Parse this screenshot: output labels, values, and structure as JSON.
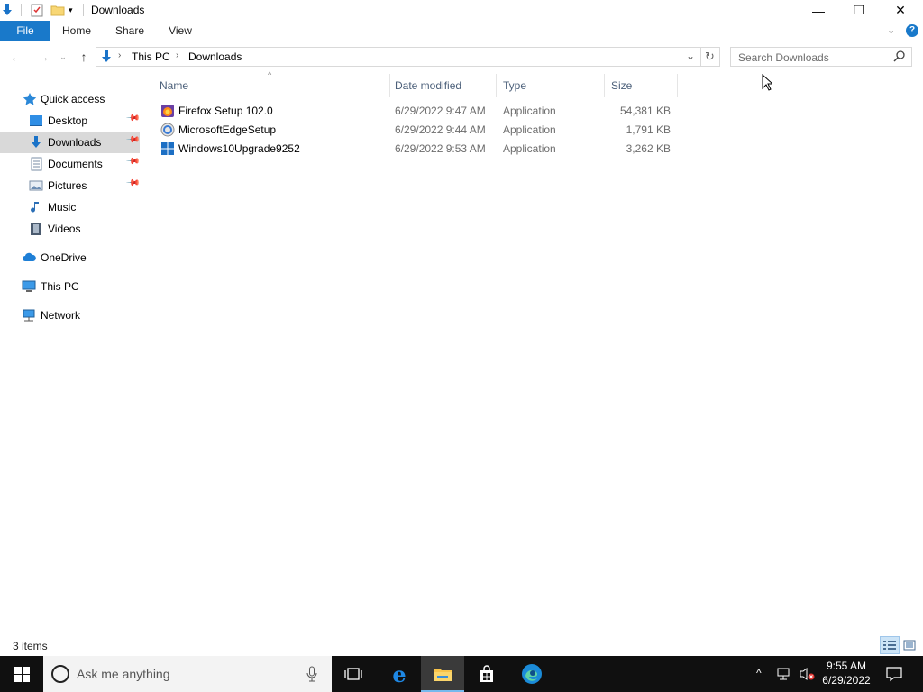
{
  "window": {
    "title": "Downloads",
    "minimize_glyph": "—",
    "maximize_glyph": "❐",
    "close_glyph": "✕"
  },
  "ribbon": {
    "tabs": [
      {
        "label": "File"
      },
      {
        "label": "Home"
      },
      {
        "label": "Share"
      },
      {
        "label": "View"
      }
    ]
  },
  "address": {
    "crumbs": [
      "This PC",
      "Downloads"
    ],
    "search_placeholder": "Search Downloads"
  },
  "nav": {
    "quick_access": "Quick access",
    "items": [
      {
        "label": "Desktop",
        "icon": "desktop-folder-icon",
        "pinned": true
      },
      {
        "label": "Downloads",
        "icon": "downloads-folder-icon",
        "pinned": true,
        "selected": true
      },
      {
        "label": "Documents",
        "icon": "documents-folder-icon",
        "pinned": true
      },
      {
        "label": "Pictures",
        "icon": "pictures-folder-icon",
        "pinned": true
      },
      {
        "label": "Music",
        "icon": "music-folder-icon",
        "pinned": false
      },
      {
        "label": "Videos",
        "icon": "videos-folder-icon",
        "pinned": false
      }
    ],
    "onedrive": "OneDrive",
    "this_pc": "This PC",
    "network": "Network"
  },
  "files": {
    "columns": {
      "name": "Name",
      "date": "Date modified",
      "type": "Type",
      "size": "Size"
    },
    "rows": [
      {
        "name": "Firefox Setup 102.0",
        "date": "6/29/2022 9:47 AM",
        "type": "Application",
        "size": "54,381 KB",
        "icon": "firefox-installer-icon"
      },
      {
        "name": "MicrosoftEdgeSetup",
        "date": "6/29/2022 9:44 AM",
        "type": "Application",
        "size": "1,791 KB",
        "icon": "edge-installer-icon"
      },
      {
        "name": "Windows10Upgrade9252",
        "date": "6/29/2022 9:53 AM",
        "type": "Application",
        "size": "3,262 KB",
        "icon": "windows-upgrade-icon"
      }
    ]
  },
  "status": {
    "item_count": "3 items"
  },
  "taskbar": {
    "search_placeholder": "Ask me anything",
    "time": "9:55 AM",
    "date": "6/29/2022"
  },
  "colors": {
    "accent": "#1979ca",
    "selected_nav": "#d9d9d9",
    "taskbar": "#101010",
    "header_text": "#4c607a"
  }
}
